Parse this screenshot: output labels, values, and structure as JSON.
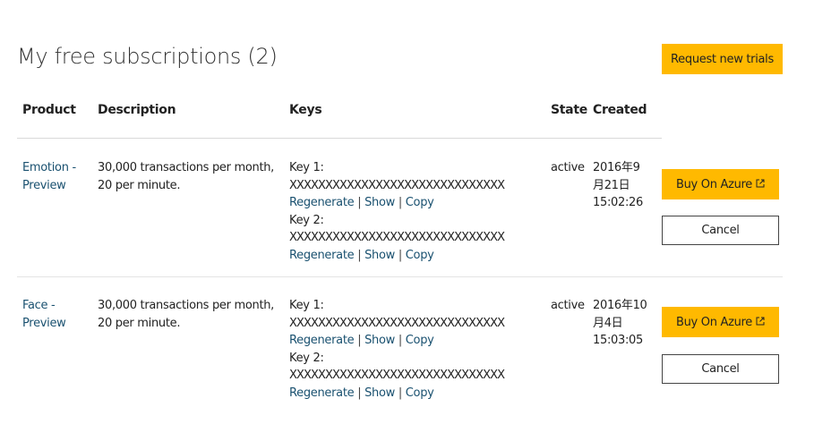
{
  "page": {
    "title": "My free subscriptions (2)",
    "request_button": "Request new trials"
  },
  "table": {
    "headers": {
      "product": "Product",
      "description": "Description",
      "keys": "Keys",
      "state": "State",
      "created": "Created"
    },
    "rows": [
      {
        "product_line1": "Emotion -",
        "product_line2": "Preview",
        "description_line1": "30,000 transactions per month,",
        "description_line2": "20 per minute.",
        "key1_label": "Key 1:",
        "key1_value": "XXXXXXXXXXXXXXXXXXXXXXXXXXXXXX",
        "key2_label": "Key 2:",
        "key2_value": "XXXXXXXXXXXXXXXXXXXXXXXXXXXXXX",
        "state": "active",
        "created_line1": "2016年9",
        "created_line2": "月21日",
        "created_line3": "15:02:26"
      },
      {
        "product_line1": "Face -",
        "product_line2": "Preview",
        "description_line1": "30,000 transactions per month,",
        "description_line2": "20 per minute.",
        "key1_label": "Key 1:",
        "key1_value": "XXXXXXXXXXXXXXXXXXXXXXXXXXXXXX",
        "key2_label": "Key 2:",
        "key2_value": "XXXXXXXXXXXXXXXXXXXXXXXXXXXXXX",
        "state": "active",
        "created_line1": "2016年10",
        "created_line2": "月4日",
        "created_line3": "15:03:05"
      }
    ],
    "actions": {
      "regenerate": "Regenerate",
      "show": "Show",
      "copy": "Copy",
      "separator": "|",
      "buy": "Buy On Azure",
      "cancel": "Cancel"
    }
  },
  "icons": {
    "buy_icon": "external-link-icon"
  },
  "colors": {
    "accent_yellow": "#ffb900",
    "link": "#1a5170",
    "text": "#222222"
  }
}
